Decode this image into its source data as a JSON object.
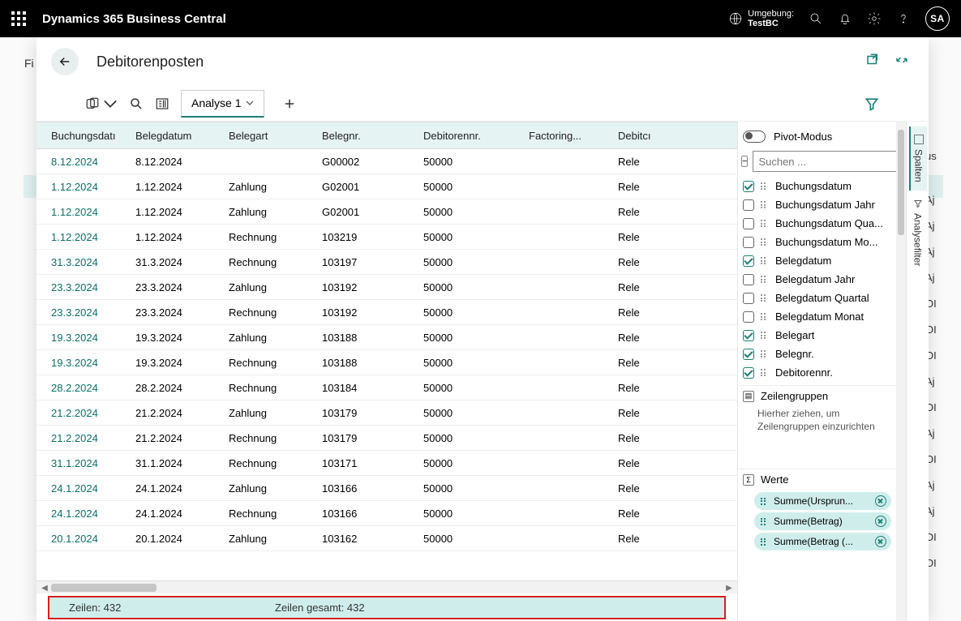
{
  "topbar": {
    "title": "Dynamics 365 Business Central",
    "env_label": "Umgebung:",
    "env_name": "TestBC",
    "avatar": "SA"
  },
  "bg": {
    "left": "Fi",
    "right_top": "us",
    "right_letters": [
      "Aj",
      "Aj",
      "Aj",
      "Aj",
      "OI",
      "OI",
      "OI",
      "Aj",
      "OI",
      "Aj",
      "OI",
      "Aj",
      "Aj",
      "OI",
      "OI"
    ]
  },
  "panel": {
    "title": "Debitorenposten",
    "tab": "Analyse 1",
    "columns": [
      "Buchungsdatı",
      "Belegdatum",
      "Belegart",
      "Belegnr.",
      "Debitorennr.",
      "Factoring...",
      "Debitcı"
    ],
    "rows": [
      {
        "post": "8.12.2024",
        "doc": "8.12.2024",
        "art": "",
        "belegnr": "G00002",
        "debnr": "50000",
        "fact": "",
        "name": "Rele"
      },
      {
        "post": "1.12.2024",
        "doc": "1.12.2024",
        "art": "Zahlung",
        "belegnr": "G02001",
        "debnr": "50000",
        "fact": "",
        "name": "Rele"
      },
      {
        "post": "1.12.2024",
        "doc": "1.12.2024",
        "art": "Zahlung",
        "belegnr": "G02001",
        "debnr": "50000",
        "fact": "",
        "name": "Rele"
      },
      {
        "post": "1.12.2024",
        "doc": "1.12.2024",
        "art": "Rechnung",
        "belegnr": "103219",
        "debnr": "50000",
        "fact": "",
        "name": "Rele"
      },
      {
        "post": "31.3.2024",
        "doc": "31.3.2024",
        "art": "Rechnung",
        "belegnr": "103197",
        "debnr": "50000",
        "fact": "",
        "name": "Rele"
      },
      {
        "post": "23.3.2024",
        "doc": "23.3.2024",
        "art": "Zahlung",
        "belegnr": "103192",
        "debnr": "50000",
        "fact": "",
        "name": "Rele"
      },
      {
        "post": "23.3.2024",
        "doc": "23.3.2024",
        "art": "Rechnung",
        "belegnr": "103192",
        "debnr": "50000",
        "fact": "",
        "name": "Rele"
      },
      {
        "post": "19.3.2024",
        "doc": "19.3.2024",
        "art": "Zahlung",
        "belegnr": "103188",
        "debnr": "50000",
        "fact": "",
        "name": "Rele"
      },
      {
        "post": "19.3.2024",
        "doc": "19.3.2024",
        "art": "Rechnung",
        "belegnr": "103188",
        "debnr": "50000",
        "fact": "",
        "name": "Rele"
      },
      {
        "post": "28.2.2024",
        "doc": "28.2.2024",
        "art": "Rechnung",
        "belegnr": "103184",
        "debnr": "50000",
        "fact": "",
        "name": "Rele"
      },
      {
        "post": "21.2.2024",
        "doc": "21.2.2024",
        "art": "Zahlung",
        "belegnr": "103179",
        "debnr": "50000",
        "fact": "",
        "name": "Rele"
      },
      {
        "post": "21.2.2024",
        "doc": "21.2.2024",
        "art": "Rechnung",
        "belegnr": "103179",
        "debnr": "50000",
        "fact": "",
        "name": "Rele"
      },
      {
        "post": "31.1.2024",
        "doc": "31.1.2024",
        "art": "Rechnung",
        "belegnr": "103171",
        "debnr": "50000",
        "fact": "",
        "name": "Rele"
      },
      {
        "post": "24.1.2024",
        "doc": "24.1.2024",
        "art": "Zahlung",
        "belegnr": "103166",
        "debnr": "50000",
        "fact": "",
        "name": "Rele"
      },
      {
        "post": "24.1.2024",
        "doc": "24.1.2024",
        "art": "Rechnung",
        "belegnr": "103166",
        "debnr": "50000",
        "fact": "",
        "name": "Rele"
      },
      {
        "post": "20.1.2024",
        "doc": "20.1.2024",
        "art": "Zahlung",
        "belegnr": "103162",
        "debnr": "50000",
        "fact": "",
        "name": "Rele"
      }
    ],
    "footer_left": "Zeilen: 432",
    "footer_mid": "Zeilen gesamt: 432"
  },
  "colpanel": {
    "pivot_label": "Pivot-Modus",
    "search_placeholder": "Suchen ...",
    "fields": [
      {
        "label": "Buchungsdatum",
        "checked": true
      },
      {
        "label": "Buchungsdatum Jahr",
        "checked": false
      },
      {
        "label": "Buchungsdatum Qua...",
        "checked": false
      },
      {
        "label": "Buchungsdatum Mo...",
        "checked": false
      },
      {
        "label": "Belegdatum",
        "checked": true
      },
      {
        "label": "Belegdatum Jahr",
        "checked": false
      },
      {
        "label": "Belegdatum Quartal",
        "checked": false
      },
      {
        "label": "Belegdatum Monat",
        "checked": false
      },
      {
        "label": "Belegart",
        "checked": true
      },
      {
        "label": "Belegnr.",
        "checked": true
      },
      {
        "label": "Debitorennr.",
        "checked": true
      }
    ],
    "rowgroups_title": "Zeilengruppen",
    "rowgroups_hint": "Hierher ziehen, um Zeilengruppen einzurichten",
    "values_title": "Werte",
    "value_chips": [
      "Summe(Ursprun...",
      "Summe(Betrag)",
      "Summe(Betrag (..."
    ]
  },
  "vtabs": {
    "columns": "Spalten",
    "filters": "Analysefilter"
  }
}
